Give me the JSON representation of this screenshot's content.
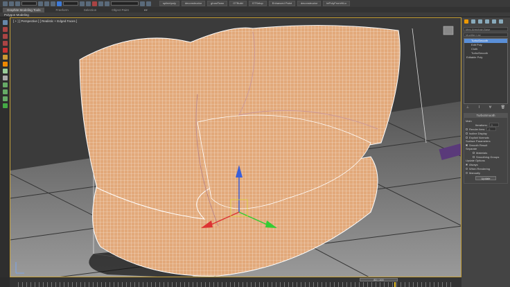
{
  "toolbar": {
    "extensions": [
      "splineIpoly",
      "deconstructor",
      "ghostTown",
      "GTBuild",
      "GTSetup",
      "Enhanced Paint",
      "deconstructor",
      "tePolyFromHiLo"
    ]
  },
  "ribbon": {
    "tabs": [
      "Graphite Modeling Tools",
      "Freeform",
      "Selection",
      "Object Paint"
    ],
    "sub_tab": "Polygon Modeling"
  },
  "viewport": {
    "label": "[ + ] [ Perspective ] [ Realistic + Edged Faces ]"
  },
  "panel": {
    "object_name": "Mex-Armchair-Base",
    "modifier_list": "Modifier List",
    "stack": [
      {
        "label": "TurboSmooth",
        "selected": true
      },
      {
        "label": "Edit Poly"
      },
      {
        "label": "Cloth"
      },
      {
        "label": "TurboSmooth"
      },
      {
        "label": "Editable Poly"
      }
    ],
    "turbosmooth": {
      "title": "TurboSmooth",
      "main": "Main",
      "iterations_label": "Iterations:",
      "iterations": "0",
      "render_iters_label": "Render Iters:",
      "render_iters": "0",
      "isoline": "Isoline Display",
      "explicit": "Explicit Normals",
      "surface": "Surface Parameters",
      "smooth_result": "Smooth Result",
      "separate": "Separate",
      "materials": "Materials",
      "smoothing_groups": "Smoothing Groups",
      "update_options": "Update Options",
      "always": "Always",
      "when_rendering": "When Rendering",
      "manually": "Manually",
      "update": "Update"
    }
  },
  "timeline": {
    "frame": "80 / 100",
    "progress": 0.8
  },
  "colors": {
    "accent": "#5a8fd8",
    "fabric": "#e0a878"
  }
}
